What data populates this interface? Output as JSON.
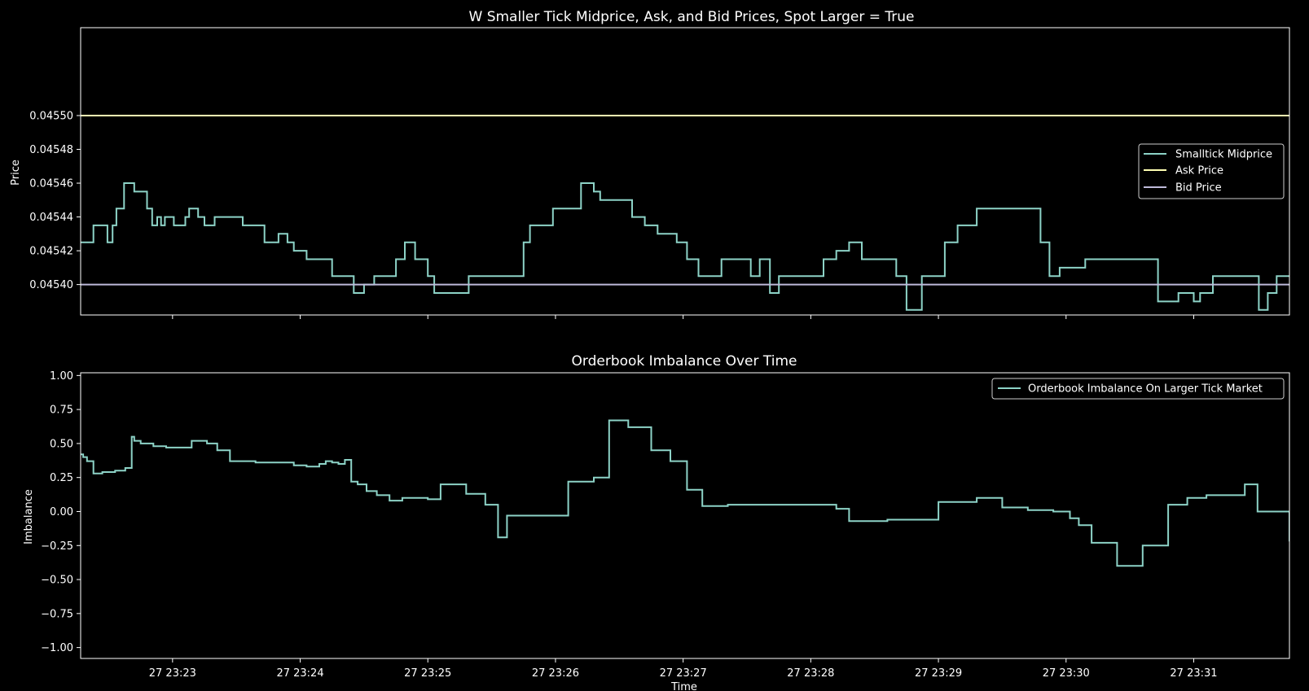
{
  "chart_data": [
    {
      "type": "line",
      "title": "W Smaller Tick Midprice, Ask, and Bid Prices, Spot Larger = True",
      "xlabel": "",
      "ylabel": "Price",
      "x_unit": "minutes after 27 23:22",
      "xlim": [
        0.28,
        9.75
      ],
      "ylim": [
        0.045382,
        0.045552
      ],
      "yticks": [
        0.0454,
        0.04542,
        0.04544,
        0.04546,
        0.04548,
        0.0455
      ],
      "ytick_labels": [
        "0.04540",
        "0.04542",
        "0.04544",
        "0.04546",
        "0.04548",
        "0.04550"
      ],
      "grid": false,
      "legend": "center-right",
      "series": [
        {
          "name": "Smalltick Midprice",
          "color": "#8dd3c7",
          "step": true,
          "x": [
            0.28,
            0.38,
            0.49,
            0.53,
            0.56,
            0.62,
            0.7,
            0.8,
            0.84,
            0.88,
            0.91,
            0.94,
            1.01,
            1.1,
            1.13,
            1.17,
            1.2,
            1.25,
            1.33,
            1.38,
            1.42,
            1.55,
            1.65,
            1.72,
            1.83,
            1.9,
            1.95,
            2.05,
            2.25,
            2.42,
            2.5,
            2.58,
            2.65,
            2.7,
            2.75,
            2.82,
            2.9,
            3.0,
            3.05,
            3.12,
            3.17,
            3.25,
            3.32,
            3.4,
            3.45,
            3.52,
            3.55,
            3.75,
            3.8,
            3.98,
            4.02,
            4.2,
            4.3,
            4.35,
            4.6,
            4.7,
            4.8,
            4.95,
            5.03,
            5.07,
            5.12,
            5.18,
            5.22,
            5.3,
            5.35,
            5.4,
            5.47,
            5.53,
            5.6,
            5.68,
            5.75,
            5.82,
            5.87,
            6.03,
            6.1,
            6.2,
            6.3,
            6.4,
            6.5,
            6.62,
            6.67,
            6.75,
            6.87,
            7.05,
            7.15,
            7.25,
            7.3,
            7.8,
            7.87,
            7.95,
            8.15,
            8.25,
            8.3,
            8.4,
            8.55,
            8.72,
            8.88,
            9.0,
            9.05,
            9.15,
            9.22,
            9.4,
            9.51,
            9.58,
            9.65,
            9.75
          ],
          "y": [
            0.045425,
            0.045435,
            0.045425,
            0.045435,
            0.045445,
            0.04546,
            0.045455,
            0.045445,
            0.045435,
            0.04544,
            0.045435,
            0.04544,
            0.045435,
            0.04544,
            0.045445,
            0.045445,
            0.04544,
            0.045435,
            0.04544,
            0.04544,
            0.04544,
            0.045435,
            0.045435,
            0.045425,
            0.04543,
            0.045425,
            0.04542,
            0.045415,
            0.045405,
            0.045395,
            0.0454,
            0.045405,
            0.045405,
            0.045405,
            0.045415,
            0.045425,
            0.045415,
            0.045405,
            0.045395,
            0.045395,
            0.045395,
            0.045395,
            0.045405,
            0.045405,
            0.045405,
            0.045405,
            0.045405,
            0.045425,
            0.045435,
            0.045445,
            0.045445,
            0.04546,
            0.045455,
            0.04545,
            0.04544,
            0.045435,
            0.04543,
            0.045425,
            0.045415,
            0.045415,
            0.045405,
            0.045405,
            0.045405,
            0.045415,
            0.045415,
            0.045415,
            0.045415,
            0.045405,
            0.045415,
            0.045395,
            0.045405,
            0.045405,
            0.045405,
            0.045405,
            0.045415,
            0.04542,
            0.045425,
            0.045415,
            0.045415,
            0.045415,
            0.045405,
            0.045385,
            0.045405,
            0.045425,
            0.045435,
            0.045435,
            0.045445,
            0.045425,
            0.045405,
            0.04541,
            0.045415,
            0.045415,
            0.045415,
            0.045415,
            0.045415,
            0.04539,
            0.045395,
            0.04539,
            0.045395,
            0.045405,
            0.045405,
            0.045405,
            0.045385,
            0.045395,
            0.045405,
            0.045405
          ]
        },
        {
          "name": "Ask Price",
          "color": "#ffffb3",
          "x": [
            0.28,
            9.75
          ],
          "y": [
            0.0455,
            0.0455
          ]
        },
        {
          "name": "Bid Price",
          "color": "#bebada",
          "x": [
            0.28,
            9.75
          ],
          "y": [
            0.0454,
            0.0454
          ]
        }
      ]
    },
    {
      "type": "line",
      "title": "Orderbook Imbalance Over Time",
      "xlabel": "Time",
      "ylabel": "Imbalance",
      "x_unit": "minutes after 27 23:22",
      "xlim": [
        0.28,
        9.75
      ],
      "ylim": [
        -1.08,
        1.02
      ],
      "yticks": [
        -1.0,
        -0.75,
        -0.5,
        -0.25,
        0.0,
        0.25,
        0.5,
        0.75,
        1.0
      ],
      "ytick_labels": [
        "−1.00",
        "−0.75",
        "−0.50",
        "−0.25",
        "0.00",
        "0.25",
        "0.50",
        "0.75",
        "1.00"
      ],
      "xticks": [
        1,
        2,
        3,
        4,
        5,
        6,
        7,
        8,
        9
      ],
      "xtick_labels": [
        "27 23:23",
        "27 23:24",
        "27 23:25",
        "27 23:26",
        "27 23:27",
        "27 23:28",
        "27 23:29",
        "27 23:30",
        "27 23:31"
      ],
      "grid": false,
      "legend": "upper-right",
      "series": [
        {
          "name": "Orderbook Imbalance On Larger Tick Market",
          "color": "#8dd3c7",
          "step": true,
          "x": [
            0.28,
            0.3,
            0.33,
            0.38,
            0.45,
            0.55,
            0.63,
            0.68,
            0.7,
            0.75,
            0.85,
            0.95,
            1.05,
            1.15,
            1.27,
            1.35,
            1.45,
            1.55,
            1.65,
            1.75,
            1.85,
            1.95,
            2.05,
            2.15,
            2.2,
            2.25,
            2.3,
            2.35,
            2.4,
            2.45,
            2.52,
            2.6,
            2.7,
            2.8,
            2.9,
            3.0,
            3.1,
            3.2,
            3.3,
            3.38,
            3.45,
            3.55,
            3.62,
            3.75,
            3.85,
            3.95,
            4.1,
            4.3,
            4.42,
            4.57,
            4.75,
            4.9,
            5.03,
            5.15,
            5.25,
            5.35,
            5.5,
            5.8,
            6.2,
            6.3,
            6.4,
            6.6,
            7.0,
            7.3,
            7.5,
            7.7,
            7.9,
            8.03,
            8.1,
            8.2,
            8.4,
            8.6,
            8.8,
            8.95,
            9.1,
            9.4,
            9.5,
            9.6,
            9.75
          ],
          "y": [
            0.42,
            0.4,
            0.37,
            0.28,
            0.29,
            0.3,
            0.32,
            0.55,
            0.52,
            0.5,
            0.48,
            0.47,
            0.47,
            0.52,
            0.5,
            0.45,
            0.37,
            0.37,
            0.36,
            0.36,
            0.36,
            0.34,
            0.33,
            0.35,
            0.37,
            0.36,
            0.35,
            0.38,
            0.22,
            0.2,
            0.15,
            0.12,
            0.08,
            0.1,
            0.1,
            0.09,
            0.2,
            0.2,
            0.13,
            0.13,
            0.05,
            -0.19,
            -0.03,
            -0.03,
            -0.03,
            -0.03,
            0.22,
            0.25,
            0.67,
            0.62,
            0.45,
            0.37,
            0.16,
            0.04,
            0.04,
            0.05,
            0.05,
            0.05,
            0.02,
            -0.07,
            -0.07,
            -0.06,
            0.07,
            0.1,
            0.03,
            0.01,
            0.0,
            -0.05,
            -0.1,
            -0.23,
            -0.4,
            -0.25,
            0.05,
            0.1,
            0.12,
            0.2,
            0.0,
            0.0,
            -0.22
          ]
        }
      ]
    }
  ]
}
